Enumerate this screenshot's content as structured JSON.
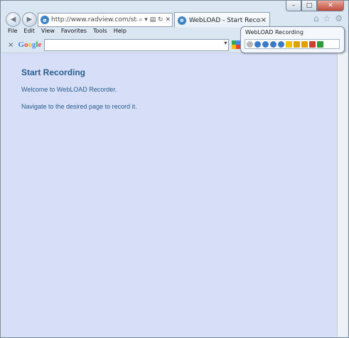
{
  "window": {
    "caption_buttons": {
      "minimize": "–",
      "maximize": "□",
      "close": "✕"
    }
  },
  "nav": {
    "back_icon": "arrow-left",
    "forward_icon": "arrow-right",
    "address_url": "http://www.radview.com/start_re",
    "address_controls": "⌕ ▾ ▤ ↻ ✕",
    "tab_title": "WebLOAD - Start Recording",
    "tab_close": "×",
    "right_icons": [
      "home-icon",
      "star-icon",
      "gear-icon"
    ]
  },
  "menu": {
    "items": [
      "File",
      "Edit",
      "View",
      "Favorites",
      "Tools",
      "Help"
    ]
  },
  "google_toolbar": {
    "close": "×",
    "logo": "Google",
    "search_value": "",
    "dropdown": "▾"
  },
  "page": {
    "heading": "Start Recording",
    "line1": "Welcome to WebLOAD Recorder.",
    "line2": "Navigate to the desired page to record it."
  },
  "recording_panel": {
    "title": "WebLOAD Recording",
    "tools": [
      {
        "name": "record-icon",
        "color": "#b8b8b8"
      },
      {
        "name": "stop-icon",
        "color": "#3a78c9"
      },
      {
        "name": "play-icon",
        "color": "#3a78c9"
      },
      {
        "name": "pause-icon",
        "color": "#3a78c9"
      },
      {
        "name": "info-icon",
        "color": "#3a78c9"
      },
      {
        "name": "message-icon",
        "color": "#f2c200"
      },
      {
        "name": "upload-icon",
        "color": "#e0a000"
      },
      {
        "name": "insert-icon",
        "color": "#e0a000"
      },
      {
        "name": "back-arrow-icon",
        "color": "#d04030"
      },
      {
        "name": "forward-arrow-icon",
        "color": "#2f9a3a"
      }
    ]
  }
}
